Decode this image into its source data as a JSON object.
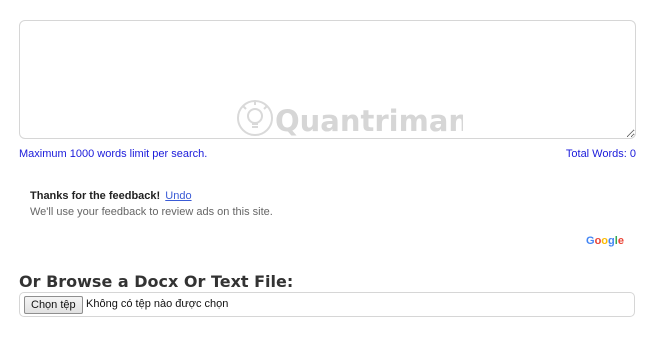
{
  "editor": {
    "text": "",
    "info_left": "Maximum 1000 words limit per search.",
    "info_right": "Total Words: 0"
  },
  "watermark": {
    "text": "Quantrimang",
    "icon": "lightbulb-icon"
  },
  "ad_feedback": {
    "thanks": "Thanks for the feedback!",
    "undo": "Undo",
    "message": "We'll use your feedback to review ads on this site."
  },
  "google_logo": {
    "letters": [
      "G",
      "o",
      "o",
      "g",
      "l",
      "e"
    ],
    "colors": [
      "#4285F4",
      "#EA4335",
      "#FBBC05",
      "#4285F4",
      "#34A853",
      "#EA4335"
    ]
  },
  "upload": {
    "title": "Or Browse a Docx Or Text File:",
    "button_label": "Chọn tệp",
    "status": "Không có tệp nào được chọn"
  },
  "colors": {
    "info_text": "#1a1adb",
    "border": "#d6d6d6",
    "link": "#3a5bd6"
  }
}
